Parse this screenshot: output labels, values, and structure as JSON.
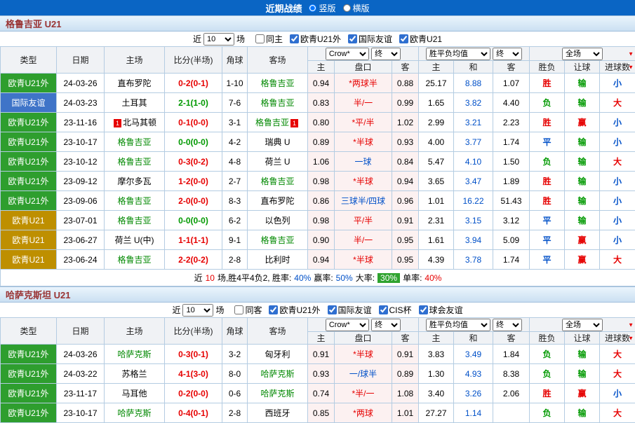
{
  "topbar": {
    "title": "近期战绩",
    "view_options": [
      {
        "label": "竖版",
        "selected": true
      },
      {
        "label": "横版",
        "selected": false
      }
    ]
  },
  "colors": {
    "topbar_bg": "#0A65C4",
    "section_title_text": "#993333",
    "win_red": "#E60000",
    "draw_loss_green": "#009900",
    "blue": "#0050C8",
    "focus_team_green": "#008800",
    "type_green_bg": "#2E9E2E",
    "type_blue_bg": "#3F74C8",
    "type_gold_bg": "#BE8F00",
    "over_rate_badge_bg": "#2FA32F",
    "handicap_section_bg": "#FCF1F1"
  },
  "header_cols": {
    "type": "类型",
    "date": "日期",
    "home": "主场",
    "score": "比分(半场)",
    "corner": "角球",
    "away": "客场",
    "odds_home": "主",
    "handicap": "盘口",
    "odds_away": "客",
    "avg_home": "主",
    "avg_draw": "和",
    "avg_away": "客",
    "result": "胜负",
    "handicap_result": "让球",
    "goals": "进球数"
  },
  "dropdowns": {
    "bookmaker": "Crow*",
    "final": "终",
    "avg": "胜平负均值",
    "final2": "终",
    "scope": "全场"
  },
  "sections": [
    {
      "title": "格鲁吉亚 U21",
      "filter": {
        "pre": "近",
        "recent_value": "10",
        "post": "场",
        "checkboxes": [
          {
            "label": "同主",
            "checked": false
          },
          {
            "label": "欧青U21外",
            "checked": true
          },
          {
            "label": "国际友谊",
            "checked": true
          },
          {
            "label": "欧青U21",
            "checked": true
          }
        ]
      },
      "rows": [
        {
          "type": "欧青U21外",
          "tc": "green",
          "date": "24-03-26",
          "home": "直布罗陀",
          "hf": false,
          "hb": "",
          "score": "0-2(0-1)",
          "sc": "red",
          "corner": "1-10",
          "away": "格鲁吉亚",
          "af": true,
          "ab": "",
          "o1": [
            "0.94",
            "*两球半",
            "0.88"
          ],
          "hc": "red",
          "o2": [
            "25.17",
            "8.88",
            "1.07"
          ],
          "res": [
            "胜",
            "red"
          ],
          "hres": [
            "输",
            "green"
          ],
          "gl": [
            "小",
            "blue"
          ]
        },
        {
          "type": "国际友谊",
          "tc": "blue",
          "date": "24-03-23",
          "home": "土耳其",
          "hf": false,
          "hb": "",
          "score": "2-1(1-0)",
          "sc": "green",
          "corner": "7-6",
          "away": "格鲁吉亚",
          "af": true,
          "ab": "",
          "o1": [
            "0.83",
            "半/一",
            "0.99"
          ],
          "hc": "red",
          "o2": [
            "1.65",
            "3.82",
            "4.40"
          ],
          "res": [
            "负",
            "green"
          ],
          "hres": [
            "输",
            "green"
          ],
          "gl": [
            "大",
            "red"
          ]
        },
        {
          "type": "欧青U21外",
          "tc": "green",
          "date": "23-11-16",
          "home": "北马其顿",
          "hf": false,
          "hb": "1",
          "score": "0-1(0-0)",
          "sc": "red",
          "corner": "3-1",
          "away": "格鲁吉亚",
          "af": true,
          "ab": "1",
          "o1": [
            "0.80",
            "*平/半",
            "1.02"
          ],
          "hc": "red",
          "o2": [
            "2.99",
            "3.21",
            "2.23"
          ],
          "res": [
            "胜",
            "red"
          ],
          "hres": [
            "赢",
            "red"
          ],
          "gl": [
            "小",
            "blue"
          ]
        },
        {
          "type": "欧青U21外",
          "tc": "green",
          "date": "23-10-17",
          "home": "格鲁吉亚",
          "hf": true,
          "hb": "",
          "score": "0-0(0-0)",
          "sc": "green",
          "corner": "4-2",
          "away": "瑞典 U",
          "af": false,
          "ab": "",
          "o1": [
            "0.89",
            "*半球",
            "0.93"
          ],
          "hc": "red",
          "o2": [
            "4.00",
            "3.77",
            "1.74"
          ],
          "res": [
            "平",
            "blue"
          ],
          "hres": [
            "输",
            "green"
          ],
          "gl": [
            "小",
            "blue"
          ]
        },
        {
          "type": "欧青U21外",
          "tc": "green",
          "date": "23-10-12",
          "home": "格鲁吉亚",
          "hf": true,
          "hb": "",
          "score": "0-3(0-2)",
          "sc": "red",
          "corner": "4-8",
          "away": "荷兰 U",
          "af": false,
          "ab": "",
          "o1": [
            "1.06",
            "一球",
            "0.84"
          ],
          "hc": "blue",
          "o2": [
            "5.47",
            "4.10",
            "1.50"
          ],
          "res": [
            "负",
            "green"
          ],
          "hres": [
            "输",
            "green"
          ],
          "gl": [
            "大",
            "red"
          ]
        },
        {
          "type": "欧青U21外",
          "tc": "green",
          "date": "23-09-12",
          "home": "摩尔多瓦",
          "hf": false,
          "hb": "",
          "score": "1-2(0-0)",
          "sc": "red",
          "corner": "2-7",
          "away": "格鲁吉亚",
          "af": true,
          "ab": "",
          "o1": [
            "0.98",
            "*半球",
            "0.94"
          ],
          "hc": "red",
          "o2": [
            "3.65",
            "3.47",
            "1.89"
          ],
          "res": [
            "胜",
            "red"
          ],
          "hres": [
            "输",
            "green"
          ],
          "gl": [
            "小",
            "blue"
          ]
        },
        {
          "type": "欧青U21外",
          "tc": "green",
          "date": "23-09-06",
          "home": "格鲁吉亚",
          "hf": true,
          "hb": "",
          "score": "2-0(0-0)",
          "sc": "red",
          "corner": "8-3",
          "away": "直布罗陀",
          "af": false,
          "ab": "",
          "o1": [
            "0.86",
            "三球半/四球",
            "0.96"
          ],
          "hc": "blue",
          "o2": [
            "1.01",
            "16.22",
            "51.43"
          ],
          "res": [
            "胜",
            "red"
          ],
          "hres": [
            "输",
            "green"
          ],
          "gl": [
            "小",
            "blue"
          ]
        },
        {
          "type": "欧青U21",
          "tc": "gold",
          "date": "23-07-01",
          "home": "格鲁吉亚",
          "hf": true,
          "hb": "",
          "score": "0-0(0-0)",
          "sc": "green",
          "corner": "6-2",
          "away": "以色列",
          "af": false,
          "ab": "",
          "o1": [
            "0.98",
            "平/半",
            "0.91"
          ],
          "hc": "red",
          "o2": [
            "2.31",
            "3.15",
            "3.12"
          ],
          "res": [
            "平",
            "blue"
          ],
          "hres": [
            "输",
            "green"
          ],
          "gl": [
            "小",
            "blue"
          ]
        },
        {
          "type": "欧青U21",
          "tc": "gold",
          "date": "23-06-27",
          "home": "荷兰 U(中)",
          "hf": false,
          "hb": "",
          "score": "1-1(1-1)",
          "sc": "red",
          "corner": "9-1",
          "away": "格鲁吉亚",
          "af": true,
          "ab": "",
          "o1": [
            "0.90",
            "半/一",
            "0.95"
          ],
          "hc": "red",
          "o2": [
            "1.61",
            "3.94",
            "5.09"
          ],
          "res": [
            "平",
            "blue"
          ],
          "hres": [
            "赢",
            "red"
          ],
          "gl": [
            "小",
            "blue"
          ]
        },
        {
          "type": "欧青U21",
          "tc": "gold",
          "date": "23-06-24",
          "home": "格鲁吉亚",
          "hf": true,
          "hb": "",
          "score": "2-2(0-2)",
          "sc": "red",
          "corner": "2-8",
          "away": "比利时",
          "af": false,
          "ab": "",
          "o1": [
            "0.94",
            "*半球",
            "0.95"
          ],
          "hc": "red",
          "o2": [
            "4.39",
            "3.78",
            "1.74"
          ],
          "res": [
            "平",
            "blue"
          ],
          "hres": [
            "赢",
            "red"
          ],
          "gl": [
            "大",
            "red"
          ]
        }
      ],
      "summary": {
        "parts": [
          {
            "t": "近",
            "c": "black"
          },
          {
            "t": "10",
            "c": "red"
          },
          {
            "t": "场,胜4平4负2, 胜率:",
            "c": "black"
          },
          {
            "t": "40%",
            "c": "blue"
          },
          {
            "t": "赢率:",
            "c": "black"
          },
          {
            "t": "50%",
            "c": "blue"
          },
          {
            "t": "大率:",
            "c": "black"
          },
          {
            "t": "30%",
            "c": "badge"
          },
          {
            "t": "单率:",
            "c": "black"
          },
          {
            "t": "40%",
            "c": "red"
          }
        ]
      }
    },
    {
      "title": "哈萨克斯坦 U21",
      "filter": {
        "pre": "近",
        "recent_value": "10",
        "post": "场",
        "checkboxes": [
          {
            "label": "同客",
            "checked": false
          },
          {
            "label": "欧青U21外",
            "checked": true
          },
          {
            "label": "国际友谊",
            "checked": true
          },
          {
            "label": "CIS杯",
            "checked": true
          },
          {
            "label": "球会友谊",
            "checked": true
          }
        ]
      },
      "rows": [
        {
          "type": "欧青U21外",
          "tc": "green",
          "date": "24-03-26",
          "home": "哈萨克斯",
          "hf": true,
          "hb": "",
          "score": "0-3(0-1)",
          "sc": "red",
          "corner": "3-2",
          "away": "匈牙利",
          "af": false,
          "ab": "",
          "o1": [
            "0.91",
            "*半球",
            "0.91"
          ],
          "hc": "red",
          "o2": [
            "3.83",
            "3.49",
            "1.84"
          ],
          "res": [
            "负",
            "green"
          ],
          "hres": [
            "输",
            "green"
          ],
          "gl": [
            "大",
            "red"
          ]
        },
        {
          "type": "欧青U21外",
          "tc": "green",
          "date": "24-03-22",
          "home": "苏格兰",
          "hf": false,
          "hb": "",
          "score": "4-1(3-0)",
          "sc": "red",
          "corner": "8-0",
          "away": "哈萨克斯",
          "af": true,
          "ab": "",
          "o1": [
            "0.93",
            "一/球半",
            "0.89"
          ],
          "hc": "blue",
          "o2": [
            "1.30",
            "4.93",
            "8.38"
          ],
          "res": [
            "负",
            "green"
          ],
          "hres": [
            "输",
            "green"
          ],
          "gl": [
            "大",
            "red"
          ]
        },
        {
          "type": "欧青U21外",
          "tc": "green",
          "date": "23-11-17",
          "home": "马耳他",
          "hf": false,
          "hb": "",
          "score": "0-2(0-0)",
          "sc": "red",
          "corner": "0-6",
          "away": "哈萨克斯",
          "af": true,
          "ab": "",
          "o1": [
            "0.74",
            "*半/一",
            "1.08"
          ],
          "hc": "red",
          "o2": [
            "3.40",
            "3.26",
            "2.06"
          ],
          "res": [
            "胜",
            "red"
          ],
          "hres": [
            "赢",
            "red"
          ],
          "gl": [
            "小",
            "blue"
          ]
        },
        {
          "type": "欧青U21外",
          "tc": "green",
          "date": "23-10-17",
          "home": "哈萨克斯",
          "hf": true,
          "hb": "",
          "score": "0-4(0-1)",
          "sc": "red",
          "corner": "2-8",
          "away": "西班牙",
          "af": false,
          "ab": "",
          "o1": [
            "0.85",
            "*两球",
            "1.01"
          ],
          "hc": "red",
          "o2": [
            "27.27",
            "1.14",
            ""
          ],
          "res": [
            "负",
            "green"
          ],
          "hres": [
            "输",
            "green"
          ],
          "gl": [
            "大",
            "red"
          ]
        }
      ],
      "summary": null
    }
  ]
}
